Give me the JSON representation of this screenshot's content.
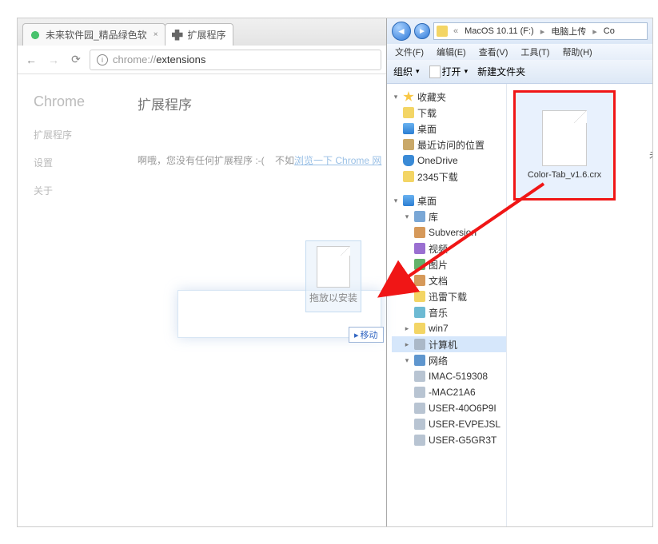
{
  "chrome": {
    "tabs": [
      {
        "title": "未来软件园_精品绿色软",
        "active": false
      },
      {
        "title": "扩展程序",
        "active": true
      }
    ],
    "omnibox": {
      "prefix": "chrome://",
      "path": "extensions"
    },
    "sidebar": {
      "brand": "Chrome",
      "items": [
        "扩展程序",
        "设置",
        "关于"
      ]
    },
    "page_title": "扩展程序",
    "empty_msg": {
      "t1": "啊哦，您没有任何扩展程序 :-(",
      "t2": "不如",
      "link": "浏览一下 Chrome 网"
    },
    "drag_label": "拖放以安装",
    "move_badge": "移动"
  },
  "explorer": {
    "breadcrumb": [
      "MacOS 10.11 (F:)",
      "电脑上传",
      "Co"
    ],
    "menu": [
      "文件(F)",
      "编辑(E)",
      "查看(V)",
      "工具(T)",
      "帮助(H)"
    ],
    "cmdbar": {
      "organize": "组织",
      "open": "打开",
      "newfolder": "新建文件夹"
    },
    "tree": {
      "favorites": {
        "label": "收藏夹",
        "items": [
          "下载",
          "桌面",
          "最近访问的位置",
          "OneDrive",
          "2345下载"
        ]
      },
      "desktop": {
        "label": "桌面"
      },
      "libraries": {
        "label": "库",
        "items": [
          "Subversion",
          "视频",
          "图片",
          "文档",
          "迅雷下载",
          "音乐"
        ]
      },
      "win7": "win7",
      "computer": "计算机",
      "network": {
        "label": "网络",
        "items": [
          "IMAC-519308",
          "-MAC21A6",
          "USER-40O6P9I",
          "USER-EVPEJSL",
          "USER-G5GR3T"
        ]
      }
    },
    "file": {
      "name": "Color-Tab_v1.6.crx"
    },
    "unknown_col": "未"
  }
}
